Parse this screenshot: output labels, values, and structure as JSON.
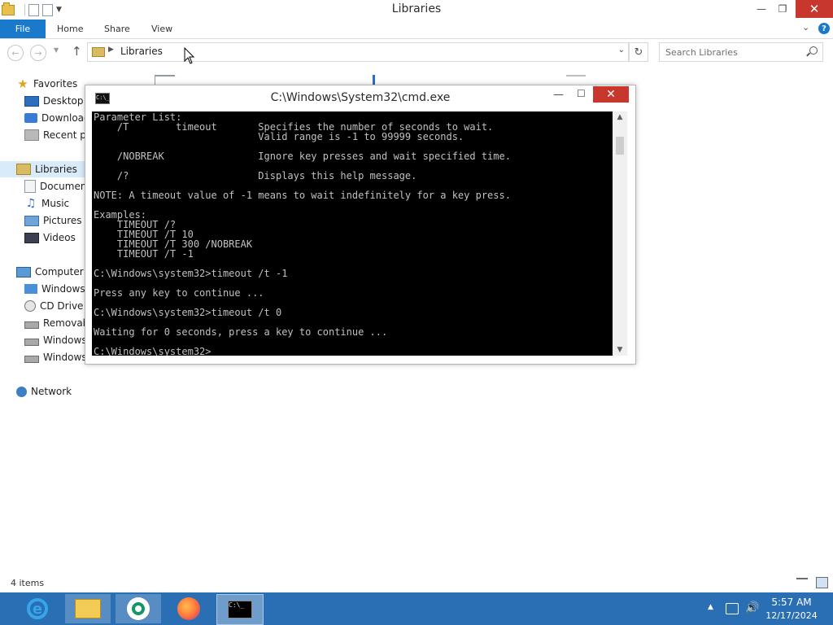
{
  "explorer": {
    "title": "Libraries",
    "ribbon": {
      "file": "File",
      "tabs": [
        "Home",
        "Share",
        "View"
      ]
    },
    "address": {
      "path": "Libraries"
    },
    "search": {
      "placeholder": "Search Libraries"
    },
    "nav": {
      "favorites": {
        "label": "Favorites",
        "items": [
          "Desktop",
          "Download",
          "Recent pla"
        ]
      },
      "libraries": {
        "label": "Libraries",
        "items": [
          "Documen",
          "Music",
          "Pictures",
          "Videos"
        ]
      },
      "computer": {
        "label": "Computer",
        "items": [
          "Windows",
          "CD Drive (",
          "Removabl",
          "Windows",
          "Windows"
        ]
      },
      "network": {
        "label": "Network"
      }
    },
    "status": {
      "items": "4 items"
    }
  },
  "cmd": {
    "title": "C:\\Windows\\System32\\cmd.exe",
    "lines": [
      "Parameter List:",
      "    /T        timeout       Specifies the number of seconds to wait.",
      "                            Valid range is -1 to 99999 seconds.",
      "",
      "    /NOBREAK                Ignore key presses and wait specified time.",
      "",
      "    /?                      Displays this help message.",
      "",
      "NOTE: A timeout value of -1 means to wait indefinitely for a key press.",
      "",
      "Examples:",
      "    TIMEOUT /?",
      "    TIMEOUT /T 10",
      "    TIMEOUT /T 300 /NOBREAK",
      "    TIMEOUT /T -1",
      "",
      "C:\\Windows\\system32>timeout /t -1",
      "",
      "Press any key to continue ...",
      "",
      "C:\\Windows\\system32>timeout /t 0",
      "",
      "Waiting for 0 seconds, press a key to continue ...",
      "",
      "C:\\Windows\\system32>"
    ]
  },
  "taskbar": {
    "time": "5:57 AM",
    "date": "12/17/2024",
    "apps": [
      "internet-explorer",
      "file-explorer",
      "app",
      "firefox",
      "command-prompt"
    ]
  },
  "colors": {
    "accent": "#1979ca",
    "taskbar": "#2a6eb3",
    "close": "#c7372d",
    "console_bg": "#000000",
    "console_fg": "#c0c0c0"
  }
}
